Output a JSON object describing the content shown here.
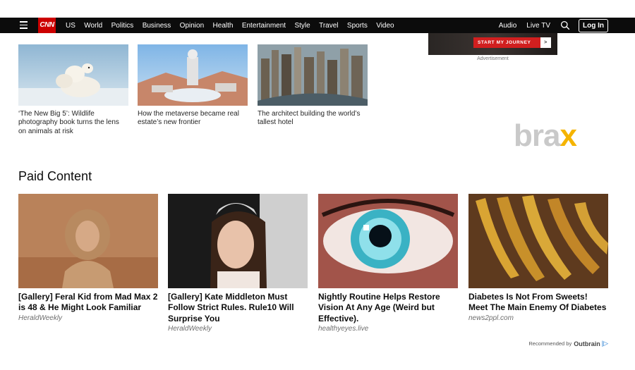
{
  "nav": {
    "logo": "CNN",
    "links": [
      "US",
      "World",
      "Politics",
      "Business",
      "Opinion",
      "Health",
      "Entertainment",
      "Style",
      "Travel",
      "Sports",
      "Video"
    ],
    "audio": "Audio",
    "live_tv": "Live TV",
    "login": "Log In"
  },
  "ad": {
    "cta": "START MY JOURNEY",
    "cta_arrow": ">",
    "label": "Advertisement"
  },
  "watermark": {
    "main": "bra",
    "accent": "x"
  },
  "stories": [
    {
      "caption": "‘The New Big 5’: Wildlife photography book turns the lens on animals at risk"
    },
    {
      "caption": "How the metaverse became real estate’s new frontier"
    },
    {
      "caption": "The architect building the world’s tallest hotel"
    }
  ],
  "paid": {
    "heading": "Paid Content",
    "items": [
      {
        "title": "[Gallery] Feral Kid from Mad Max 2 is 48 & He Might Look Familiar",
        "source": "HeraldWeekly"
      },
      {
        "title": "[Gallery] Kate Middleton Must Follow Strict Rules. Rule10 Will Surprise You",
        "source": "HeraldWeekly"
      },
      {
        "title": "Nightly Routine Helps Restore Vision At Any Age (Weird but Effective).",
        "source": "healthyeyes.live"
      },
      {
        "title": "Diabetes Is Not From Sweets! Meet The Main Enemy Of Diabetes",
        "source": "news2ppl.com"
      }
    ],
    "recommended_by": "Recommended by",
    "brand": "Outbrain",
    "brand_icon": "|▷"
  },
  "colors": {
    "nav_bg": "#0c0c0c",
    "cnn_red": "#cc0000",
    "brax_accent": "#f5b400"
  }
}
